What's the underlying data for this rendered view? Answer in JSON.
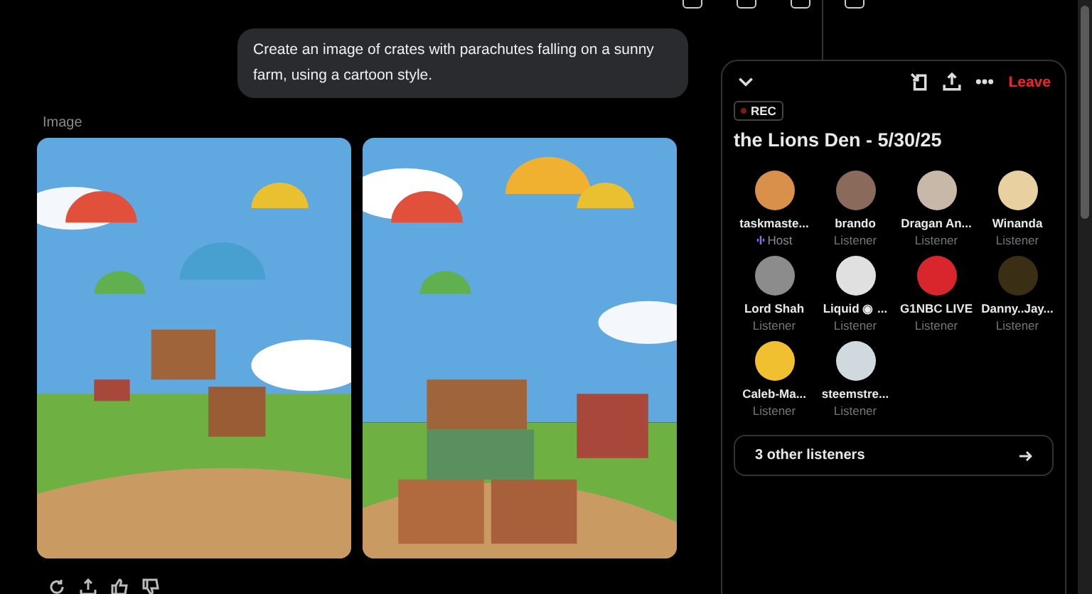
{
  "prompt": {
    "text": "Create an image of crates with parachutes falling on a sunny farm, using a cartoon style."
  },
  "result": {
    "label": "Image"
  },
  "space": {
    "leave": "Leave",
    "rec": "REC",
    "title": "the Lions Den - 5/30/25",
    "participants": [
      {
        "name": "taskmaste...",
        "role": "Host",
        "kind": "host",
        "color": "#d9904a"
      },
      {
        "name": "brando",
        "role": "Listener",
        "kind": "listener",
        "color": "#8a6a5a"
      },
      {
        "name": "Dragan An...",
        "role": "Listener",
        "kind": "listener",
        "color": "#c8b8a8"
      },
      {
        "name": "Winanda",
        "role": "Listener",
        "kind": "listener",
        "color": "#e8d0a0"
      },
      {
        "name": "Lord Shah",
        "role": "Listener",
        "kind": "listener",
        "color": "#8c8c8c"
      },
      {
        "name": "Liquid ◉ ...",
        "role": "Listener",
        "kind": "listener",
        "color": "#e0e0e0"
      },
      {
        "name": "G1NBC LIVE",
        "role": "Listener",
        "kind": "listener",
        "color": "#d8262c"
      },
      {
        "name": "Danny..Jay...",
        "role": "Listener",
        "kind": "listener",
        "color": "#3a2e14"
      },
      {
        "name": "Caleb-Ma...",
        "role": "Listener",
        "kind": "listener",
        "color": "#f0c030"
      },
      {
        "name": "steemstre...",
        "role": "Listener",
        "kind": "listener",
        "color": "#cfd9de"
      }
    ],
    "more": "3 other listeners"
  }
}
